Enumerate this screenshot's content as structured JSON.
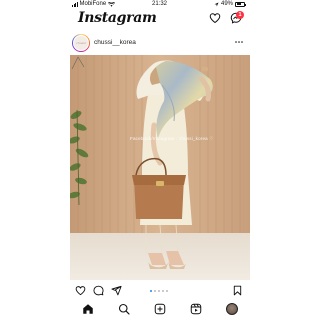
{
  "status_bar": {
    "carrier": "MobiFone",
    "time": "21:32",
    "battery": "49%"
  },
  "header": {
    "logo": "Instagram",
    "dm_badge_count": "1"
  },
  "post": {
    "username": "chussi__korea",
    "avatar_text": "chussi",
    "watermark": "Facebook/Instagram : chussi_korea ♡",
    "carousel": {
      "count": 5,
      "active_index": 0
    }
  },
  "icons": {
    "header": [
      "heart-icon",
      "direct-message-icon"
    ],
    "post_header": [
      "more-options-icon"
    ],
    "actions": [
      "like-icon",
      "comment-icon",
      "share-icon",
      "save-icon"
    ],
    "tab_bar": [
      "home-icon",
      "search-icon",
      "new-post-icon",
      "reels-icon",
      "profile-icon"
    ]
  },
  "colors": {
    "badge": "#ff3040",
    "carousel_active": "#1e88e5",
    "text": "#111111"
  }
}
